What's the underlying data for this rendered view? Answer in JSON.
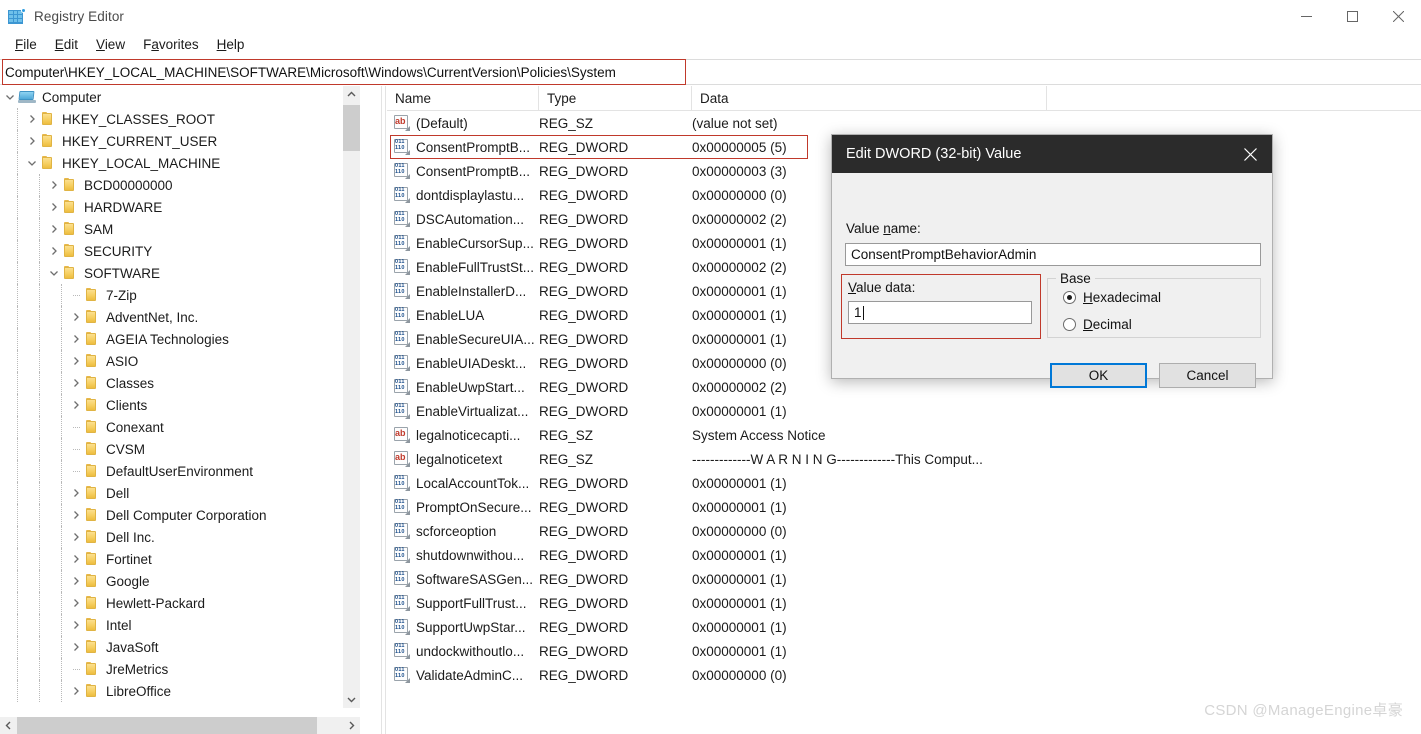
{
  "window": {
    "title": "Registry Editor",
    "icon": "registry-editor-icon",
    "minimize_label": "—",
    "maximize_label": "□",
    "close_label": "✕"
  },
  "menubar": {
    "items": [
      {
        "label": "File",
        "accel": "F"
      },
      {
        "label": "Edit",
        "accel": "E"
      },
      {
        "label": "View",
        "accel": "V"
      },
      {
        "label": "Favorites",
        "accel": "a"
      },
      {
        "label": "Help",
        "accel": "H"
      }
    ]
  },
  "address_bar": {
    "value": "Computer\\HKEY_LOCAL_MACHINE\\SOFTWARE\\Microsoft\\Windows\\CurrentVersion\\Policies\\System",
    "highlight_color": "#c0392b"
  },
  "tree": {
    "nodes": [
      {
        "label": "Computer",
        "indent": 0,
        "state": "expanded",
        "icon": "computer-icon"
      },
      {
        "label": "HKEY_CLASSES_ROOT",
        "indent": 1,
        "state": "collapsed",
        "icon": "folder-icon"
      },
      {
        "label": "HKEY_CURRENT_USER",
        "indent": 1,
        "state": "collapsed",
        "icon": "folder-icon"
      },
      {
        "label": "HKEY_LOCAL_MACHINE",
        "indent": 1,
        "state": "expanded",
        "icon": "folder-icon"
      },
      {
        "label": "BCD00000000",
        "indent": 2,
        "state": "collapsed",
        "icon": "folder-icon"
      },
      {
        "label": "HARDWARE",
        "indent": 2,
        "state": "collapsed",
        "icon": "folder-icon"
      },
      {
        "label": "SAM",
        "indent": 2,
        "state": "collapsed",
        "icon": "folder-icon"
      },
      {
        "label": "SECURITY",
        "indent": 2,
        "state": "collapsed",
        "icon": "folder-icon"
      },
      {
        "label": "SOFTWARE",
        "indent": 2,
        "state": "expanded",
        "icon": "folder-icon"
      },
      {
        "label": "7-Zip",
        "indent": 3,
        "state": "leaf",
        "icon": "folder-icon"
      },
      {
        "label": "AdventNet, Inc.",
        "indent": 3,
        "state": "collapsed",
        "icon": "folder-icon"
      },
      {
        "label": "AGEIA Technologies",
        "indent": 3,
        "state": "collapsed",
        "icon": "folder-icon"
      },
      {
        "label": "ASIO",
        "indent": 3,
        "state": "collapsed",
        "icon": "folder-icon"
      },
      {
        "label": "Classes",
        "indent": 3,
        "state": "collapsed",
        "icon": "folder-icon"
      },
      {
        "label": "Clients",
        "indent": 3,
        "state": "collapsed",
        "icon": "folder-icon"
      },
      {
        "label": "Conexant",
        "indent": 3,
        "state": "leaf",
        "icon": "folder-icon"
      },
      {
        "label": "CVSM",
        "indent": 3,
        "state": "leaf",
        "icon": "folder-icon"
      },
      {
        "label": "DefaultUserEnvironment",
        "indent": 3,
        "state": "leaf",
        "icon": "folder-icon"
      },
      {
        "label": "Dell",
        "indent": 3,
        "state": "collapsed",
        "icon": "folder-icon"
      },
      {
        "label": "Dell Computer Corporation",
        "indent": 3,
        "state": "collapsed",
        "icon": "folder-icon"
      },
      {
        "label": "Dell Inc.",
        "indent": 3,
        "state": "collapsed",
        "icon": "folder-icon"
      },
      {
        "label": "Fortinet",
        "indent": 3,
        "state": "collapsed",
        "icon": "folder-icon"
      },
      {
        "label": "Google",
        "indent": 3,
        "state": "collapsed",
        "icon": "folder-icon"
      },
      {
        "label": "Hewlett-Packard",
        "indent": 3,
        "state": "collapsed",
        "icon": "folder-icon"
      },
      {
        "label": "Intel",
        "indent": 3,
        "state": "collapsed",
        "icon": "folder-icon"
      },
      {
        "label": "JavaSoft",
        "indent": 3,
        "state": "collapsed",
        "icon": "folder-icon"
      },
      {
        "label": "JreMetrics",
        "indent": 3,
        "state": "leaf",
        "icon": "folder-icon"
      },
      {
        "label": "LibreOffice",
        "indent": 3,
        "state": "collapsed",
        "icon": "folder-icon"
      }
    ]
  },
  "value_list": {
    "columns": [
      "Name",
      "Type",
      "Data"
    ],
    "rows": [
      {
        "name": "(Default)",
        "type": "REG_SZ",
        "data": "(value not set)",
        "icon": "string-value-icon",
        "highlighted": false
      },
      {
        "name": "ConsentPromptB...",
        "type": "REG_DWORD",
        "data": "0x00000005 (5)",
        "icon": "dword-value-icon",
        "highlighted": true
      },
      {
        "name": "ConsentPromptB...",
        "type": "REG_DWORD",
        "data": "0x00000003 (3)",
        "icon": "dword-value-icon",
        "highlighted": false
      },
      {
        "name": "dontdisplaylastu...",
        "type": "REG_DWORD",
        "data": "0x00000000 (0)",
        "icon": "dword-value-icon",
        "highlighted": false
      },
      {
        "name": "DSCAutomation...",
        "type": "REG_DWORD",
        "data": "0x00000002 (2)",
        "icon": "dword-value-icon",
        "highlighted": false
      },
      {
        "name": "EnableCursorSup...",
        "type": "REG_DWORD",
        "data": "0x00000001 (1)",
        "icon": "dword-value-icon",
        "highlighted": false
      },
      {
        "name": "EnableFullTrustSt...",
        "type": "REG_DWORD",
        "data": "0x00000002 (2)",
        "icon": "dword-value-icon",
        "highlighted": false
      },
      {
        "name": "EnableInstallerD...",
        "type": "REG_DWORD",
        "data": "0x00000001 (1)",
        "icon": "dword-value-icon",
        "highlighted": false
      },
      {
        "name": "EnableLUA",
        "type": "REG_DWORD",
        "data": "0x00000001 (1)",
        "icon": "dword-value-icon",
        "highlighted": false
      },
      {
        "name": "EnableSecureUIA...",
        "type": "REG_DWORD",
        "data": "0x00000001 (1)",
        "icon": "dword-value-icon",
        "highlighted": false
      },
      {
        "name": "EnableUIADeskt...",
        "type": "REG_DWORD",
        "data": "0x00000000 (0)",
        "icon": "dword-value-icon",
        "highlighted": false
      },
      {
        "name": "EnableUwpStart...",
        "type": "REG_DWORD",
        "data": "0x00000002 (2)",
        "icon": "dword-value-icon",
        "highlighted": false
      },
      {
        "name": "EnableVirtualizat...",
        "type": "REG_DWORD",
        "data": "0x00000001 (1)",
        "icon": "dword-value-icon",
        "highlighted": false
      },
      {
        "name": "legalnoticecapti...",
        "type": "REG_SZ",
        "data": "System Access Notice",
        "icon": "string-value-icon",
        "highlighted": false
      },
      {
        "name": "legalnoticetext",
        "type": "REG_SZ",
        "data": "-------------W A R N I N G-------------This Comput...",
        "icon": "string-value-icon",
        "highlighted": false
      },
      {
        "name": "LocalAccountTok...",
        "type": "REG_DWORD",
        "data": "0x00000001 (1)",
        "icon": "dword-value-icon",
        "highlighted": false
      },
      {
        "name": "PromptOnSecure...",
        "type": "REG_DWORD",
        "data": "0x00000001 (1)",
        "icon": "dword-value-icon",
        "highlighted": false
      },
      {
        "name": "scforceoption",
        "type": "REG_DWORD",
        "data": "0x00000000 (0)",
        "icon": "dword-value-icon",
        "highlighted": false
      },
      {
        "name": "shutdownwithou...",
        "type": "REG_DWORD",
        "data": "0x00000001 (1)",
        "icon": "dword-value-icon",
        "highlighted": false
      },
      {
        "name": "SoftwareSASGen...",
        "type": "REG_DWORD",
        "data": "0x00000001 (1)",
        "icon": "dword-value-icon",
        "highlighted": false
      },
      {
        "name": "SupportFullTrust...",
        "type": "REG_DWORD",
        "data": "0x00000001 (1)",
        "icon": "dword-value-icon",
        "highlighted": false
      },
      {
        "name": "SupportUwpStar...",
        "type": "REG_DWORD",
        "data": "0x00000001 (1)",
        "icon": "dword-value-icon",
        "highlighted": false
      },
      {
        "name": "undockwithoutlo...",
        "type": "REG_DWORD",
        "data": "0x00000001 (1)",
        "icon": "dword-value-icon",
        "highlighted": false
      },
      {
        "name": "ValidateAdminC...",
        "type": "REG_DWORD",
        "data": "0x00000000 (0)",
        "icon": "dword-value-icon",
        "highlighted": false
      }
    ]
  },
  "dialog": {
    "title": "Edit DWORD (32-bit) Value",
    "close_label": "✕",
    "value_name_label": "Value name:",
    "value_name_accel": "n",
    "value_name": "ConsentPromptBehaviorAdmin",
    "value_data_label": "Value data:",
    "value_data_accel": "V",
    "value_data": "1",
    "base_group_label": "Base",
    "base_options": [
      {
        "label": "Hexadecimal",
        "accel": "H",
        "selected": true
      },
      {
        "label": "Decimal",
        "accel": "D",
        "selected": false
      }
    ],
    "ok_label": "OK",
    "cancel_label": "Cancel"
  },
  "watermark": {
    "text": "CSDN @ManageEngine卓豪"
  }
}
